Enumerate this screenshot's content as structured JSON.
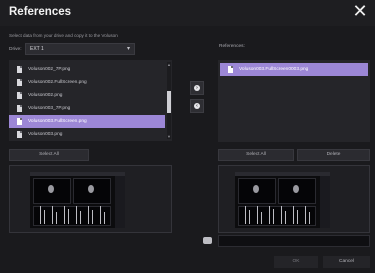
{
  "window": {
    "title": "References",
    "close_icon": "close-icon"
  },
  "instruction": "Select data from your drive and copy it to the Voluson",
  "drive": {
    "label": "Drive:",
    "value": "EXT 1"
  },
  "file_list": {
    "items": [
      {
        "name": "Voluson002_7P.png",
        "selected": false
      },
      {
        "name": "Voluson002.FullScreen.png",
        "selected": false
      },
      {
        "name": "Voluson002.png",
        "selected": false
      },
      {
        "name": "Voluson003_7P.png",
        "selected": false
      },
      {
        "name": "Voluson003.FullScreen.png",
        "selected": true
      },
      {
        "name": "Voluson003.png",
        "selected": false
      }
    ]
  },
  "references": {
    "label": "References:",
    "items": [
      {
        "name": "Voluson003.FullScreen0003.png",
        "selected": true
      }
    ]
  },
  "buttons": {
    "select_all_left": "Select All",
    "select_all_right": "Select All",
    "delete": "Delete",
    "ok": "OK",
    "cancel": "Cancel"
  },
  "colors": {
    "selection": "#9c87d6",
    "background": "#1a1a1d",
    "panel": "#252529"
  }
}
